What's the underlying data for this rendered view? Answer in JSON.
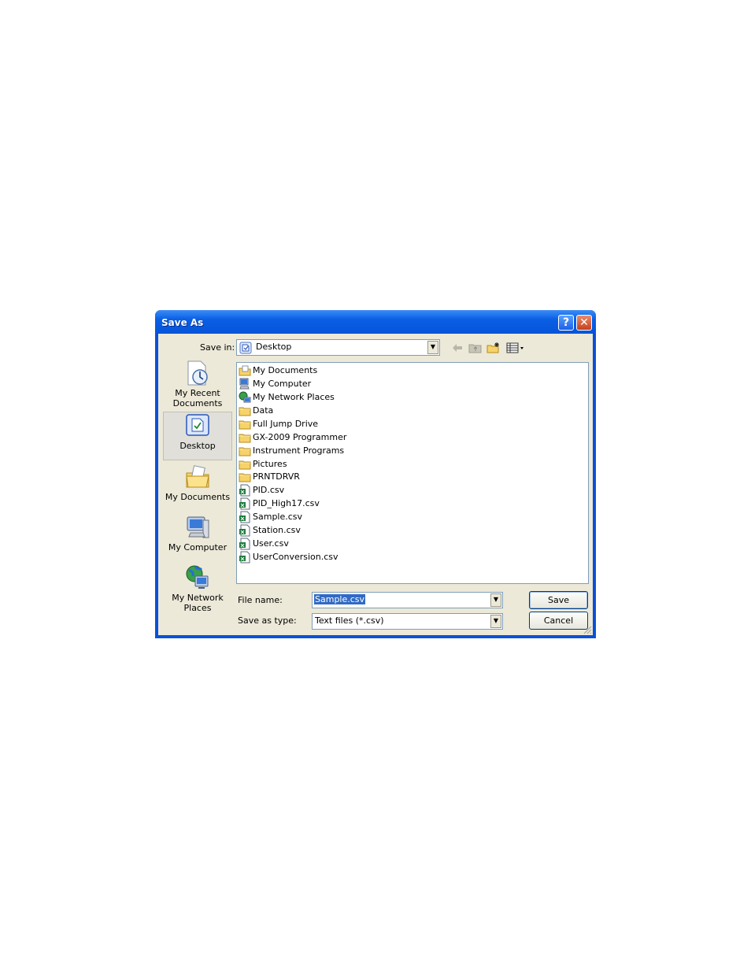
{
  "dialog": {
    "title": "Save As"
  },
  "titlebar": {
    "help_label": "?",
    "close_label": "✕"
  },
  "save_in": {
    "label": "Save in:",
    "value": "Desktop"
  },
  "places": [
    {
      "label": "My Recent Documents",
      "icon": "recent-documents-icon"
    },
    {
      "label": "Desktop",
      "icon": "desktop-icon"
    },
    {
      "label": "My Documents",
      "icon": "my-documents-icon"
    },
    {
      "label": "My Computer",
      "icon": "my-computer-icon"
    },
    {
      "label": "My Network Places",
      "icon": "network-places-icon"
    }
  ],
  "files": [
    {
      "name": "My Documents",
      "type": "mydocs"
    },
    {
      "name": "My Computer",
      "type": "computer"
    },
    {
      "name": "My Network Places",
      "type": "network"
    },
    {
      "name": "Data",
      "type": "folder"
    },
    {
      "name": "Full Jump Drive",
      "type": "folder"
    },
    {
      "name": "GX-2009 Programmer",
      "type": "folder"
    },
    {
      "name": "Instrument Programs",
      "type": "folder"
    },
    {
      "name": "Pictures",
      "type": "folder"
    },
    {
      "name": "PRNTDRVR",
      "type": "folder"
    },
    {
      "name": "PID.csv",
      "type": "csv"
    },
    {
      "name": "PID_High17.csv",
      "type": "csv"
    },
    {
      "name": "Sample.csv",
      "type": "csv"
    },
    {
      "name": "Station.csv",
      "type": "csv"
    },
    {
      "name": "User.csv",
      "type": "csv"
    },
    {
      "name": "UserConversion.csv",
      "type": "csv"
    }
  ],
  "file_name": {
    "label": "File name:",
    "value": "Sample.csv"
  },
  "save_as_type": {
    "label": "Save as type:",
    "value": "Text files (*.csv)"
  },
  "buttons": {
    "save": "Save",
    "cancel": "Cancel"
  },
  "colors": {
    "titlebar": "#0a5fe4",
    "face": "#ece9d8",
    "selection": "#316ac5"
  }
}
